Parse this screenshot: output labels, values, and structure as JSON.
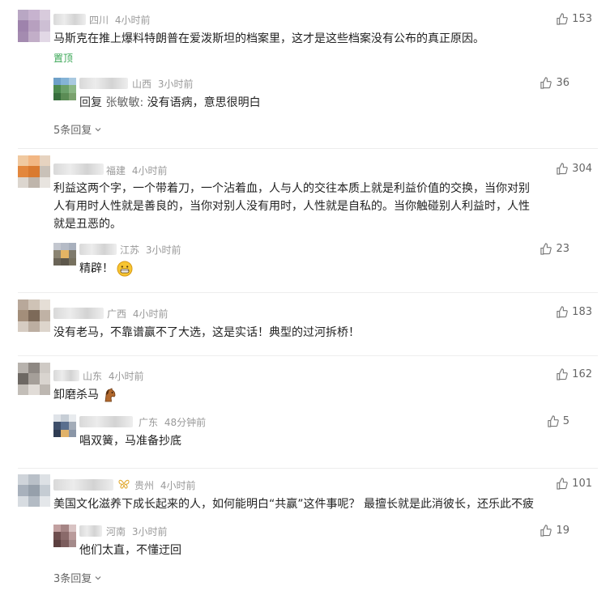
{
  "comments": [
    {
      "location": "四川",
      "time": "4小时前",
      "likes": "153",
      "text": "马斯克在推上爆料特朗普在爱泼斯坦的档案里，这才是这些档案没有公布的真正原因。",
      "pinned_label": "置顶",
      "replies": [
        {
          "location": "山西",
          "time": "3小时前",
          "likes": "36",
          "reply_prefix": "回复",
          "reply_to": "张敏敏:",
          "text": "没有语病，意思很明白"
        }
      ],
      "more_replies": "5条回复"
    },
    {
      "location": "福建",
      "time": "4小时前",
      "likes": "304",
      "text_lines": [
        "利益这两个字，一个带着刀，一个沾着血，人与人的交往本质上就是利益价值的交换，当你对别",
        "人有用时人性就是善良的，当你对别人没有用时，人性就是自私的。当你触碰别人利益时，人性",
        "就是丑恶的。"
      ],
      "replies": [
        {
          "location": "江苏",
          "time": "3小时前",
          "likes": "23",
          "text": "精辟！"
        }
      ]
    },
    {
      "location": "广西",
      "time": "4小时前",
      "likes": "183",
      "text": "没有老马，不靠谱赢不了大选，这是实话！典型的过河拆桥！"
    },
    {
      "location": "山东",
      "time": "4小时前",
      "likes": "162",
      "text": "卸磨杀马",
      "replies": [
        {
          "location": "广东",
          "time": "48分钟前",
          "likes": "5",
          "text": "唱双簧，马准备抄底"
        }
      ]
    },
    {
      "location": "贵州",
      "time": "4小时前",
      "likes": "101",
      "text": "美国文化滋养下成长起来的人，如何能明白“共赢”这件事呢？ 最擅长就是此消彼长，还乐此不疲",
      "replies": [
        {
          "location": "河南",
          "time": "3小时前",
          "likes": "19",
          "text": "他们太直，不懂迂回"
        }
      ],
      "more_replies": "3条回复"
    }
  ],
  "icons": {
    "like": "thumbs-up-icon",
    "expand": "chevron-down-icon",
    "grin": "grinning-emoji-icon",
    "horse": "horse-emoji-icon",
    "badge": "butterfly-badge-icon"
  },
  "colors": {
    "pinned": "#3aa756",
    "meta": "#999999",
    "divider": "#ededed"
  }
}
